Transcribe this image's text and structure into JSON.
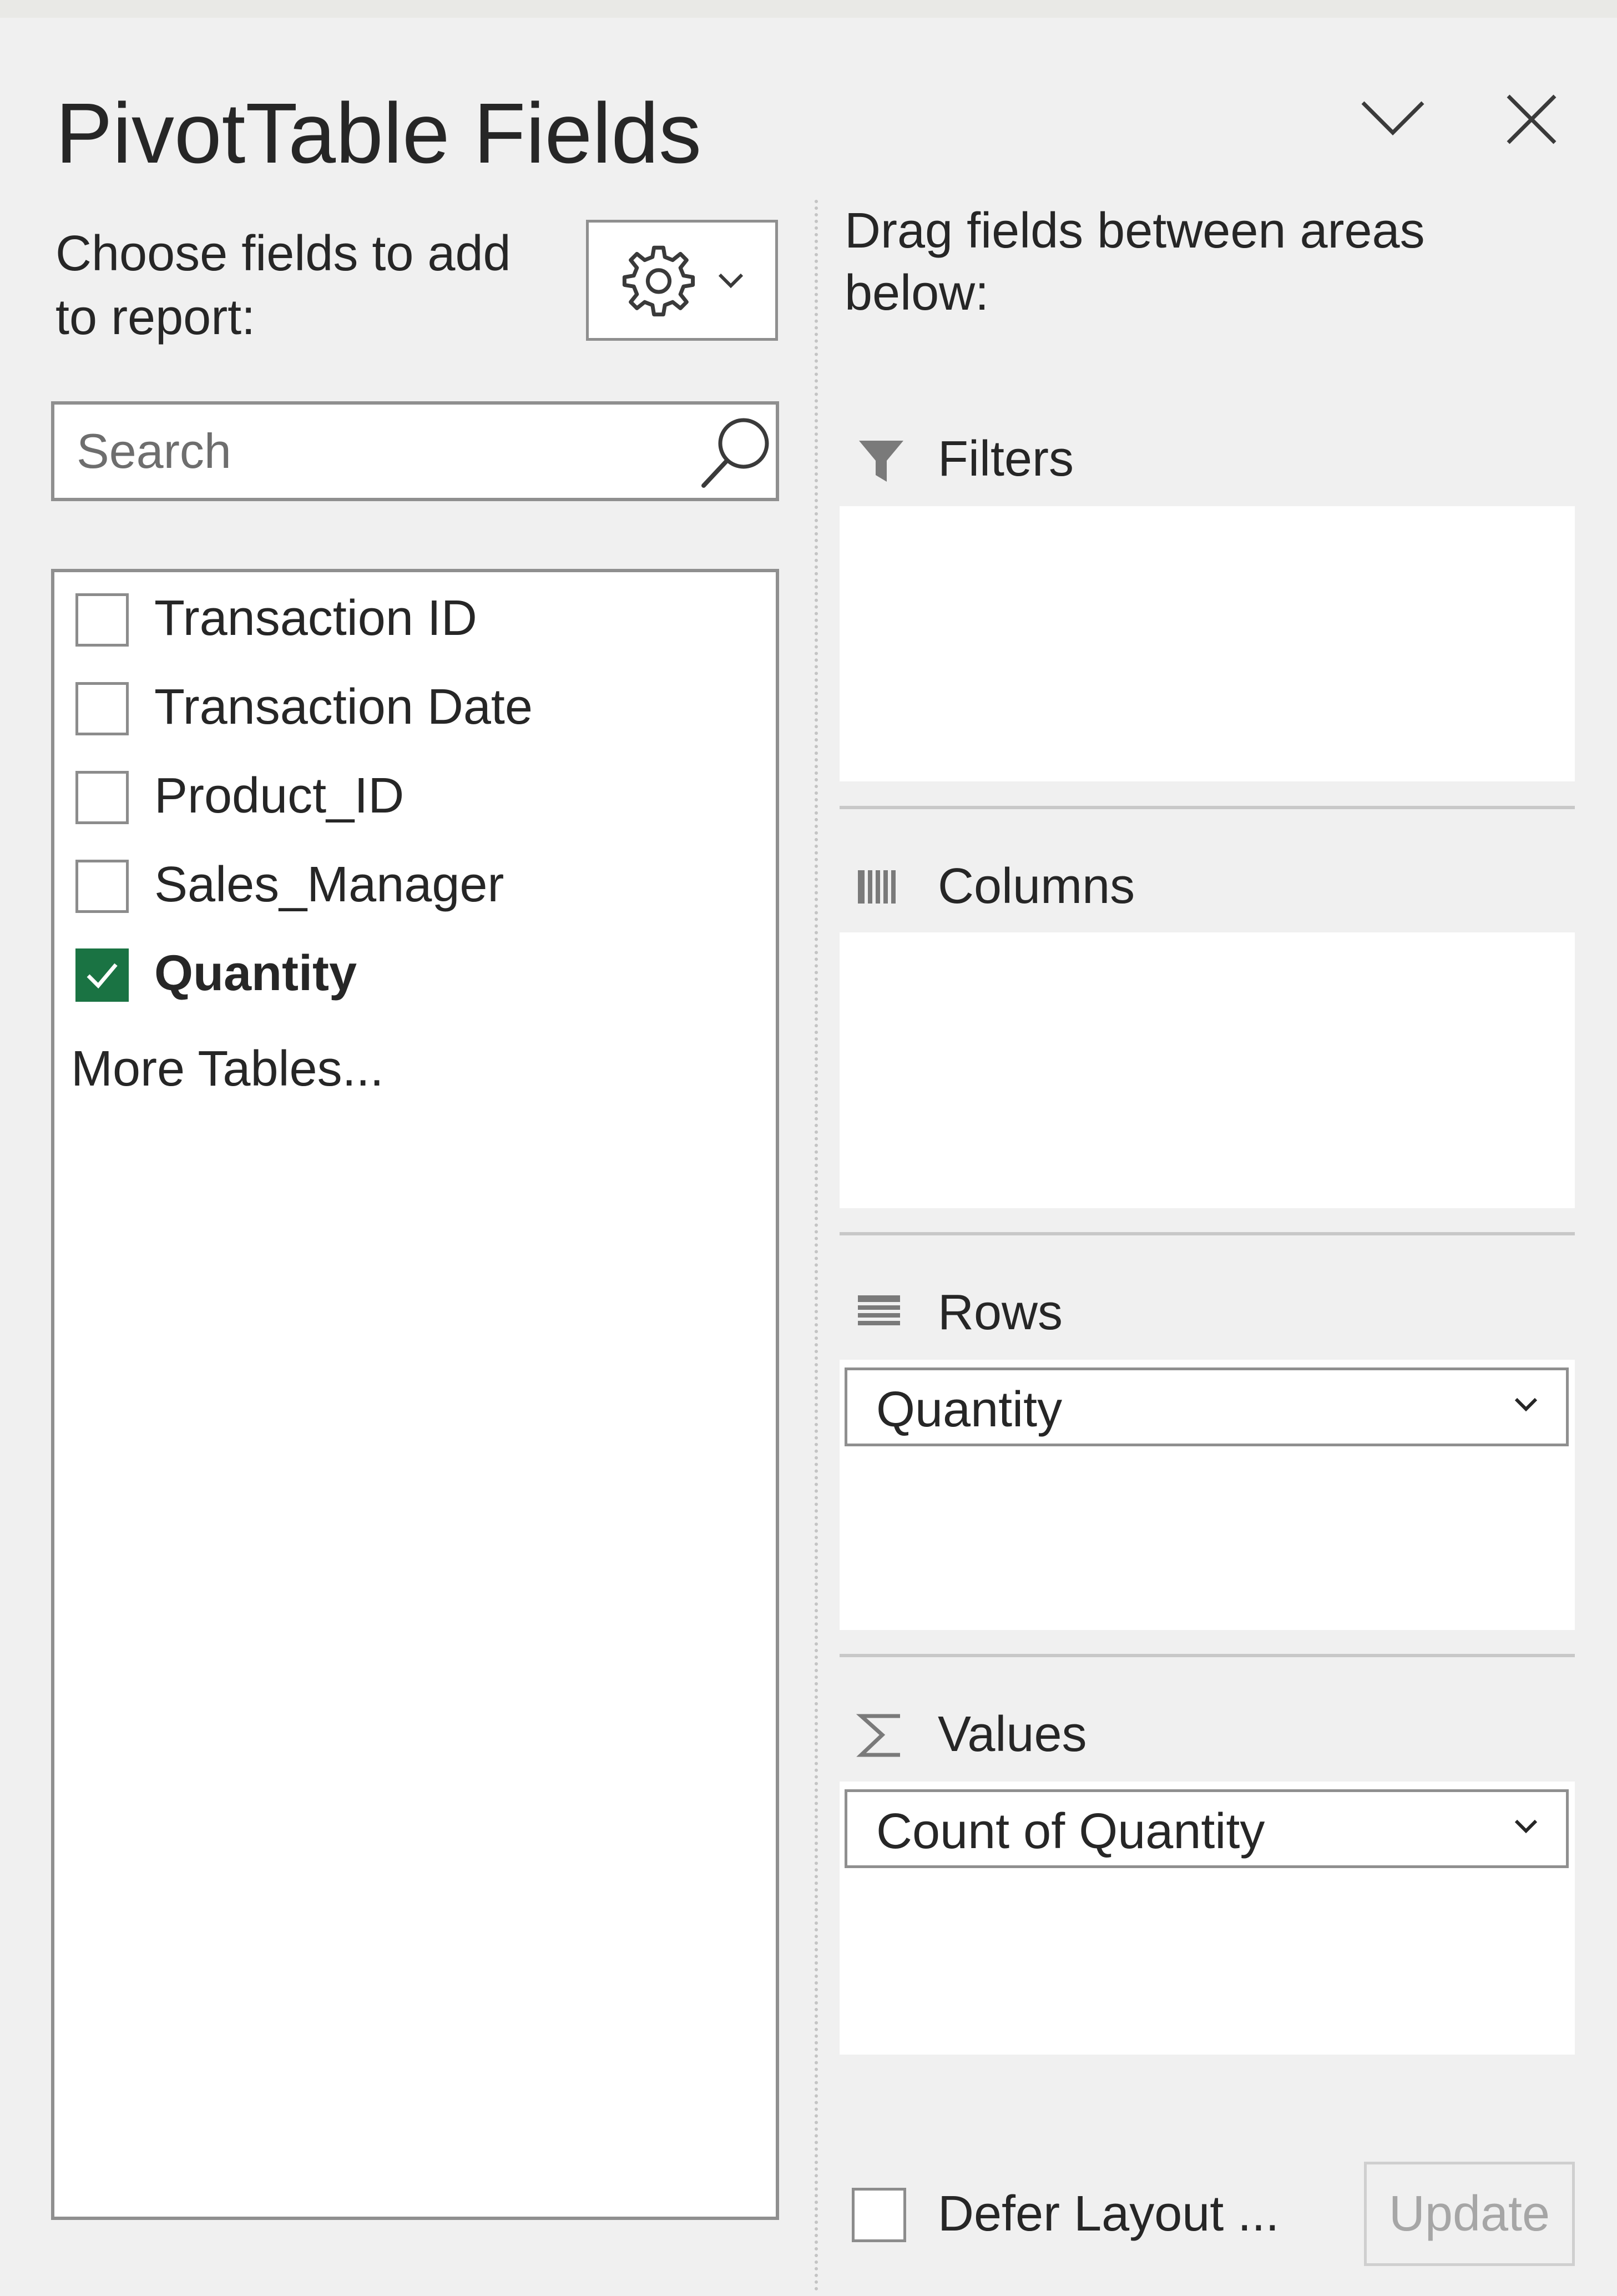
{
  "panel": {
    "title": "PivotTable Fields",
    "choose_label": "Choose fields to add to report:",
    "drag_label": "Drag fields between areas below:"
  },
  "search": {
    "placeholder": "Search",
    "value": ""
  },
  "fields": [
    {
      "label": "Transaction ID",
      "checked": false
    },
    {
      "label": "Transaction Date",
      "checked": false
    },
    {
      "label": "Product_ID",
      "checked": false
    },
    {
      "label": "Sales_Manager",
      "checked": false
    },
    {
      "label": "Quantity",
      "checked": true
    }
  ],
  "more_tables": "More Tables...",
  "areas": {
    "filters": {
      "label": "Filters",
      "icon": "filter-icon",
      "items": []
    },
    "columns": {
      "label": "Columns",
      "icon": "columns-icon",
      "items": []
    },
    "rows": {
      "label": "Rows",
      "icon": "rows-icon",
      "items": [
        "Quantity"
      ]
    },
    "values": {
      "label": "Values",
      "icon": "sigma-icon",
      "items": [
        "Count of Quantity"
      ]
    }
  },
  "footer": {
    "defer_label": "Defer Layout ...",
    "defer_checked": false,
    "update_label": "Update",
    "update_enabled": false
  },
  "colors": {
    "checkbox_checked": "#1a7343",
    "background": "#f0f0f0",
    "border": "#8f8f8f"
  }
}
